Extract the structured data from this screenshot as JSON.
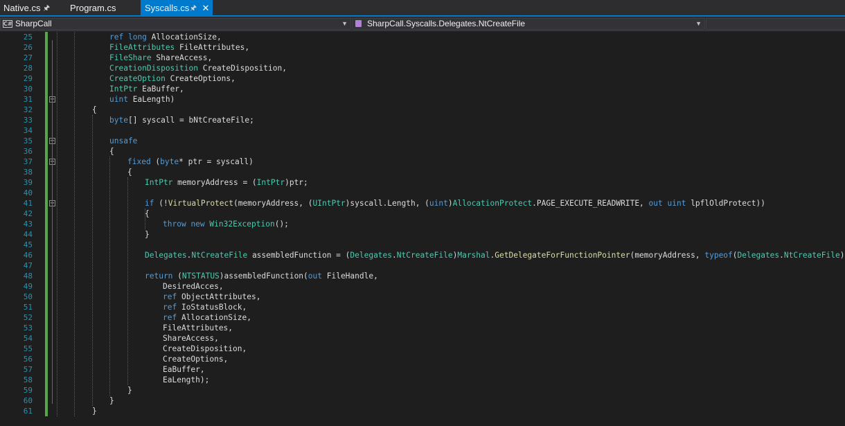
{
  "tabs": [
    {
      "label": "Native.cs",
      "pinned": true,
      "active": false
    },
    {
      "label": "Program.cs",
      "pinned": false,
      "active": false
    },
    {
      "label": "Syscalls.cs",
      "pinned": true,
      "active": true
    }
  ],
  "navbar": {
    "project": "SharpCall",
    "member": "SharpCall.Syscalls.Delegates.NtCreateFile"
  },
  "icons": {
    "pin": "pin-icon",
    "close": "close-icon",
    "project": "csharp-project-icon",
    "member": "method-icon",
    "dropdown": "chevron-down-icon",
    "fold": "collapse-icon"
  },
  "colors": {
    "keyword": "#569cd6",
    "type": "#4ec9b0",
    "method": "#dcdcaa",
    "plain": "#dcdcdc",
    "line_number": "#2b91af",
    "accent": "#007acc",
    "changed_margin": "#57a64a"
  },
  "code_lines": [
    {
      "n": "25",
      "tokens": [
        [
          "t",
          "ref"
        ],
        [
          " "
        ],
        [
          "k",
          "long"
        ],
        [
          " AllocationSize,"
        ]
      ]
    },
    {
      "n": "26",
      "tokens": [
        [
          "t",
          "FileAttributes"
        ],
        [
          " FileAttributes,"
        ]
      ]
    },
    {
      "n": "27",
      "tokens": [
        [
          "t",
          "FileShare"
        ],
        [
          " ShareAccess,"
        ]
      ]
    },
    {
      "n": "28",
      "tokens": [
        [
          "t",
          "CreationDisposition"
        ],
        [
          " CreateDisposition,"
        ]
      ]
    },
    {
      "n": "29",
      "tokens": [
        [
          "t",
          "CreateOption"
        ],
        [
          " CreateOptions,"
        ]
      ]
    },
    {
      "n": "30",
      "tokens": [
        [
          "t",
          "IntPtr"
        ],
        [
          " EaBuffer,"
        ]
      ]
    },
    {
      "n": "31",
      "tokens": [
        [
          "k",
          "uint"
        ],
        [
          " EaLength)"
        ]
      ]
    },
    {
      "n": "32",
      "tokens": [
        [
          "{"
        ]
      ]
    },
    {
      "n": "33",
      "tokens": [
        [
          "k",
          "byte"
        ],
        [
          "[] syscall = bNtCreateFile;"
        ]
      ]
    },
    {
      "n": "34",
      "tokens": []
    },
    {
      "n": "35",
      "tokens": [
        [
          "k",
          "unsafe"
        ]
      ]
    },
    {
      "n": "36",
      "tokens": [
        [
          "{"
        ]
      ]
    },
    {
      "n": "37",
      "tokens": [
        [
          "k",
          "fixed"
        ],
        [
          " ("
        ],
        [
          "k",
          "byte"
        ],
        [
          "* ptr = syscall)"
        ]
      ]
    },
    {
      "n": "38",
      "tokens": [
        [
          "{"
        ]
      ]
    },
    {
      "n": "39",
      "tokens": [
        [
          "t",
          "IntPtr"
        ],
        [
          " memoryAddress = ("
        ],
        [
          "t",
          "IntPtr"
        ],
        [
          ")ptr;"
        ]
      ]
    },
    {
      "n": "40",
      "tokens": []
    },
    {
      "n": "41",
      "tokens": [
        [
          "k",
          "if"
        ],
        [
          " (!"
        ],
        [
          "f",
          "VirtualProtect"
        ],
        [
          "(memoryAddress, ("
        ],
        [
          "t",
          "UIntPtr"
        ],
        [
          ")syscall.Length, ("
        ],
        [
          "k",
          "uint"
        ],
        [
          ")"
        ],
        [
          "t",
          "AllocationProtect"
        ],
        [
          ".PAGE_EXECUTE_READWRITE, "
        ],
        [
          "k",
          "out"
        ],
        [
          " "
        ],
        [
          "k",
          "uint"
        ],
        [
          " lpflOldProtect))"
        ]
      ]
    },
    {
      "n": "42",
      "tokens": [
        [
          "{"
        ]
      ]
    },
    {
      "n": "43",
      "tokens": [
        [
          "k",
          "throw"
        ],
        [
          " "
        ],
        [
          "k",
          "new"
        ],
        [
          " "
        ],
        [
          "t",
          "Win32Exception"
        ],
        [
          "();"
        ]
      ]
    },
    {
      "n": "44",
      "tokens": [
        [
          "}"
        ]
      ]
    },
    {
      "n": "45",
      "tokens": []
    },
    {
      "n": "46",
      "tokens": [
        [
          "t",
          "Delegates"
        ],
        [
          "."
        ],
        [
          "t",
          "NtCreateFile"
        ],
        [
          " assembledFunction = ("
        ],
        [
          "t",
          "Delegates"
        ],
        [
          "."
        ],
        [
          "t",
          "NtCreateFile"
        ],
        [
          ")"
        ],
        [
          "t",
          "Marshal"
        ],
        [
          "."
        ],
        [
          "f",
          "GetDelegateForFunctionPointer"
        ],
        [
          "(memoryAddress, "
        ],
        [
          "k",
          "typeof"
        ],
        [
          "("
        ],
        [
          "t",
          "Delegates"
        ],
        [
          "."
        ],
        [
          "t",
          "NtCreateFile"
        ],
        [
          "));"
        ]
      ]
    },
    {
      "n": "47",
      "tokens": []
    },
    {
      "n": "48",
      "tokens": [
        [
          "k",
          "return"
        ],
        [
          " ("
        ],
        [
          "t",
          "NTSTATUS"
        ],
        [
          ")assembledFunction("
        ],
        [
          "k",
          "out"
        ],
        [
          " FileHandle,"
        ]
      ]
    },
    {
      "n": "49",
      "tokens": [
        [
          "DesiredAcces,"
        ]
      ]
    },
    {
      "n": "50",
      "tokens": [
        [
          "k",
          "ref"
        ],
        [
          " ObjectAttributes,"
        ]
      ]
    },
    {
      "n": "51",
      "tokens": [
        [
          "k",
          "ref"
        ],
        [
          " IoStatusBlock,"
        ]
      ]
    },
    {
      "n": "52",
      "tokens": [
        [
          "k",
          "ref"
        ],
        [
          " AllocationSize,"
        ]
      ]
    },
    {
      "n": "53",
      "tokens": [
        [
          "FileAttributes,"
        ]
      ]
    },
    {
      "n": "54",
      "tokens": [
        [
          "ShareAccess,"
        ]
      ]
    },
    {
      "n": "55",
      "tokens": [
        [
          "CreateDisposition,"
        ]
      ]
    },
    {
      "n": "56",
      "tokens": [
        [
          "CreateOptions,"
        ]
      ]
    },
    {
      "n": "57",
      "tokens": [
        [
          "EaBuffer,"
        ]
      ]
    },
    {
      "n": "58",
      "tokens": [
        [
          "EaLength);"
        ]
      ]
    },
    {
      "n": "59",
      "tokens": [
        [
          "}"
        ]
      ]
    },
    {
      "n": "60",
      "tokens": [
        [
          "}"
        ]
      ]
    },
    {
      "n": "61",
      "tokens": [
        [
          "}"
        ]
      ]
    }
  ]
}
